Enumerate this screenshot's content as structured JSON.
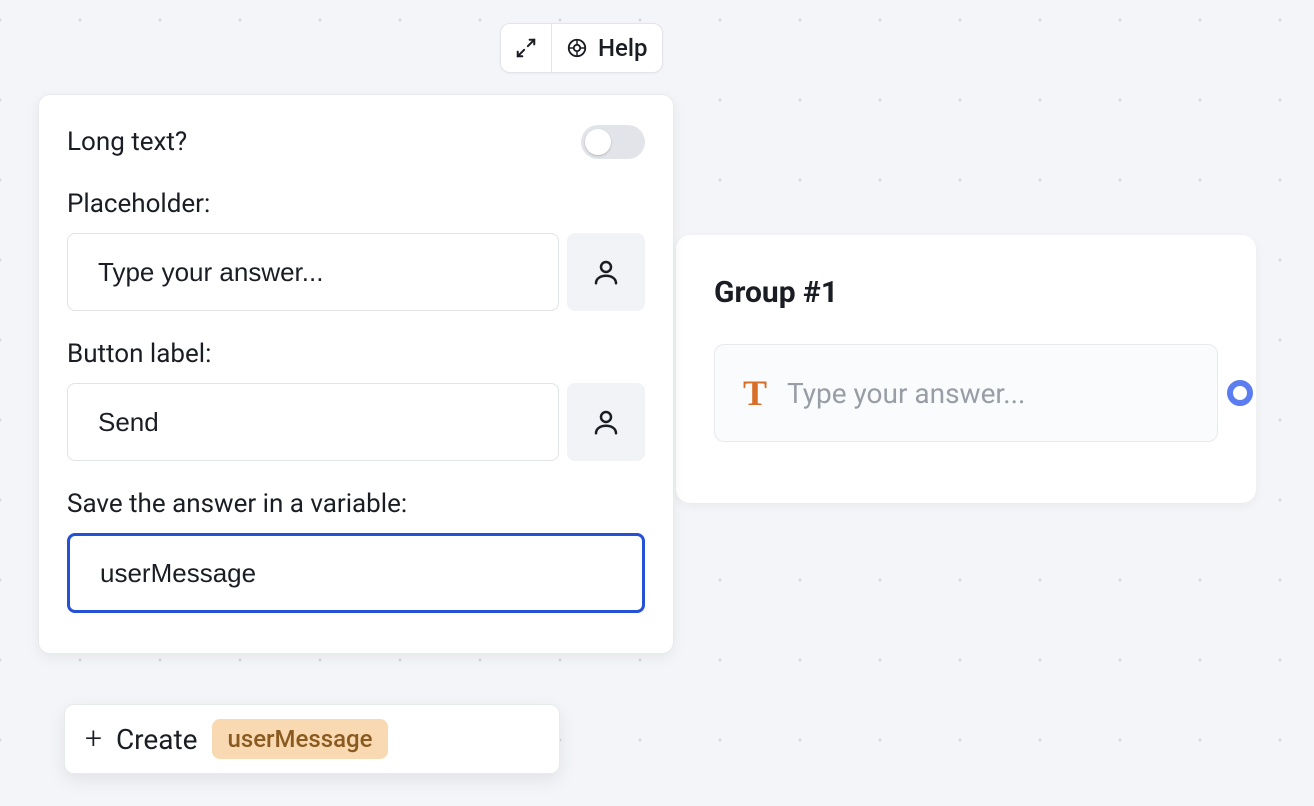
{
  "toolbar": {
    "help_label": "Help"
  },
  "panel": {
    "long_text_label": "Long text?",
    "long_text_on": false,
    "placeholder_label": "Placeholder:",
    "placeholder_value": "Type your answer...",
    "button_label_label": "Button label:",
    "button_label_value": "Send",
    "variable_label": "Save the answer in a variable:",
    "variable_value": "userMessage"
  },
  "dropdown": {
    "create_label": "Create",
    "token": "userMessage"
  },
  "group": {
    "title": "Group #1",
    "block_placeholder": "Type your answer..."
  }
}
